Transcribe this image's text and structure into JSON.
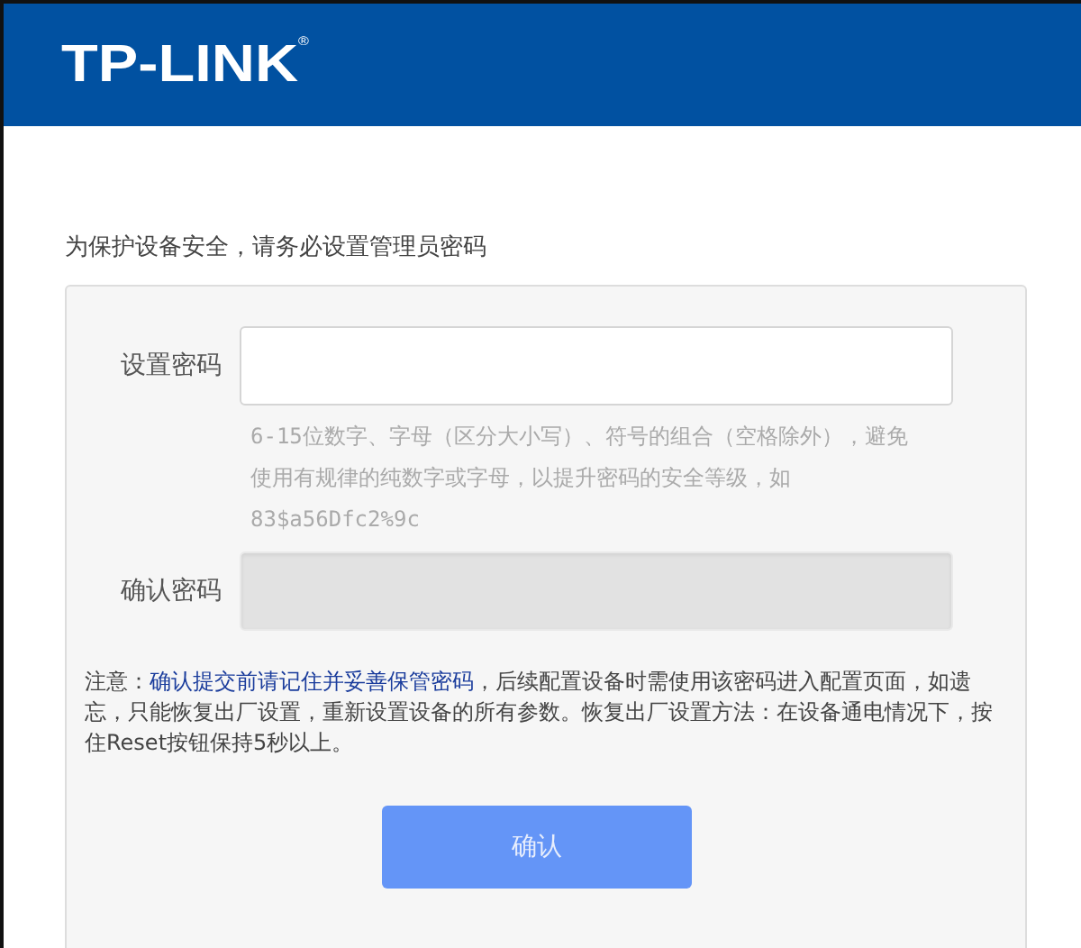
{
  "header": {
    "logo": "TP-LINK$^{®}$"
  },
  "intro": "为保护设备安全，请务必设置管理员密码",
  "form": {
    "fields": [
      {
        "label": "设置密码",
        "disabled": false,
        "hint": "6-15位数字、字母（区分大小写）、符号的组合（空格除外），避免使用有规律的纯数字或字母，以提升密码的安全等级，如83$a56Dfc2%9c"
      },
      {
        "label": "确认密码",
        "disabled": true
      }
    ],
    "note": "注意：**确认提交前请记住并妥善保管密码**，后续配置设备时需使用该密码进入配置页面，如遗忘，只能恢复出厂设置，重新设置设备的所有参数。恢复出厂设置方法：在设备通电情况下，按住Reset按钮保持5秒以上。",
    "button": "确认"
  }
}
